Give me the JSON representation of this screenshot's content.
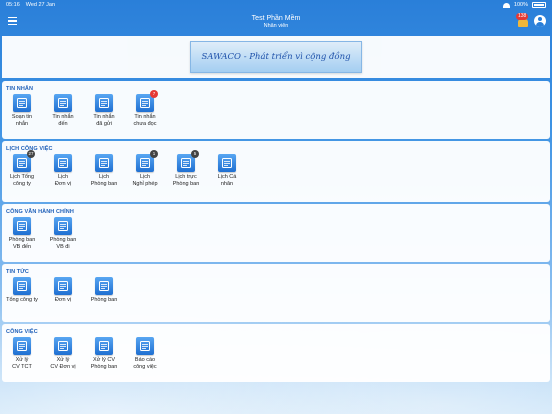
{
  "status": {
    "time": "05:16",
    "date": "Wed 27 Jan",
    "battery": "100%"
  },
  "header": {
    "title": "Test Phần Mềm",
    "subtitle": "Nhân viên",
    "notif_count": "138"
  },
  "banner": {
    "text": "SAWACO - Phát triển vì cộng đồng"
  },
  "sections": [
    {
      "title": "TIN NHẮN",
      "items": [
        {
          "label": "Soạn tin\nnhắn",
          "icon": "compose-icon",
          "badge": ""
        },
        {
          "label": "Tin nhắn\nđến",
          "icon": "inbox-icon",
          "badge": ""
        },
        {
          "label": "Tin nhắn\nđã gửi",
          "icon": "sent-icon",
          "badge": ""
        },
        {
          "label": "Tin nhắn\nchưa đọc",
          "icon": "unread-icon",
          "badge": "7"
        }
      ]
    },
    {
      "title": "LỊCH CÔNG VIỆC",
      "items": [
        {
          "label": "Lịch Tổng\ncông ty",
          "icon": "calendar-company-icon",
          "badge": "27"
        },
        {
          "label": "Lịch\nĐơn vị",
          "icon": "calendar-unit-icon",
          "badge": ""
        },
        {
          "label": "Lịch\nPhòng ban",
          "icon": "calendar-dept-icon",
          "badge": ""
        },
        {
          "label": "Lịch\nNghỉ phép",
          "icon": "calendar-leave-icon",
          "badge": "1"
        },
        {
          "label": "Lịch trực\nPhòng ban",
          "icon": "calendar-duty-icon",
          "badge": "5"
        },
        {
          "label": "Lịch Cá\nnhân",
          "icon": "calendar-personal-icon",
          "badge": ""
        }
      ]
    },
    {
      "title": "CÔNG VĂN HÀNH CHÍNH",
      "items": [
        {
          "label": "Phòng ban\nVB đến",
          "icon": "doc-in-icon",
          "badge": ""
        },
        {
          "label": "Phòng ban\nVB đi",
          "icon": "doc-out-icon",
          "badge": ""
        }
      ]
    },
    {
      "title": "TIN TỨC",
      "items": [
        {
          "label": "Tổng công ty",
          "icon": "news-company-icon",
          "badge": ""
        },
        {
          "label": "Đơn vị",
          "icon": "news-unit-icon",
          "badge": ""
        },
        {
          "label": "Phòng ban",
          "icon": "news-dept-icon",
          "badge": ""
        }
      ]
    },
    {
      "title": "CÔNG VIỆC",
      "items": [
        {
          "label": "Xử lý\nCV TCT",
          "icon": "task-company-icon",
          "badge": ""
        },
        {
          "label": "Xử lý\nCV Đơn vị",
          "icon": "task-unit-icon",
          "badge": ""
        },
        {
          "label": "Xử lý CV\nPhòng ban",
          "icon": "task-dept-icon",
          "badge": ""
        },
        {
          "label": "Báo cáo\ncông việc",
          "icon": "report-icon",
          "badge": ""
        }
      ]
    }
  ]
}
